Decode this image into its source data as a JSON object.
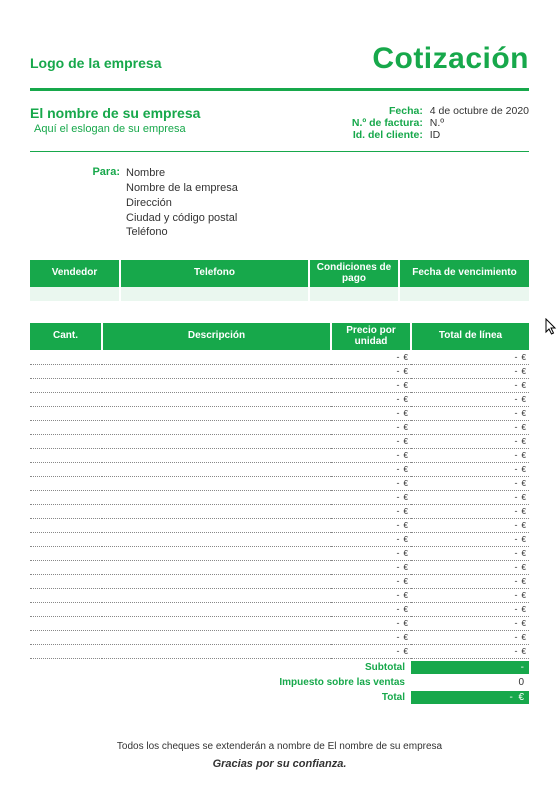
{
  "header": {
    "logo_text": "Logo de la empresa",
    "title": "Cotización"
  },
  "company": {
    "name": "El nombre de su empresa",
    "slogan": "Aquí el eslogan de su empresa",
    "date_label": "Fecha:",
    "date_value": "4 de octubre de 2020",
    "invoice_label": "N.º de factura:",
    "invoice_value": "N.º",
    "client_id_label": "Id. del cliente:",
    "client_id_value": "ID"
  },
  "para": {
    "label": "Para:",
    "lines": {
      "l0": "Nombre",
      "l1": "Nombre de la empresa",
      "l2": "Dirección",
      "l3": "Ciudad y código postal",
      "l4": "Teléfono"
    }
  },
  "info_headers": {
    "seller": "Vendedor",
    "phone": "Telefono",
    "terms": "Condiciones de pago",
    "due": "Fecha de vencimiento"
  },
  "items_headers": {
    "qty": "Cant.",
    "desc": "Descripción",
    "price": "Precio por unidad",
    "line": "Total de línea"
  },
  "row": {
    "price_blank": "-",
    "total_blank": "-",
    "euro": "€"
  },
  "totals": {
    "subtotal_label": "Subtotal",
    "subtotal_value": "-",
    "tax_label": "Impuesto sobre las ventas",
    "tax_value": "0",
    "total_label": "Total",
    "total_value": "-",
    "euro": "€"
  },
  "footer": {
    "line1": "Todos los cheques se extenderán a nombre de  El nombre de su empresa",
    "line2": "Gracias por su confianza."
  }
}
